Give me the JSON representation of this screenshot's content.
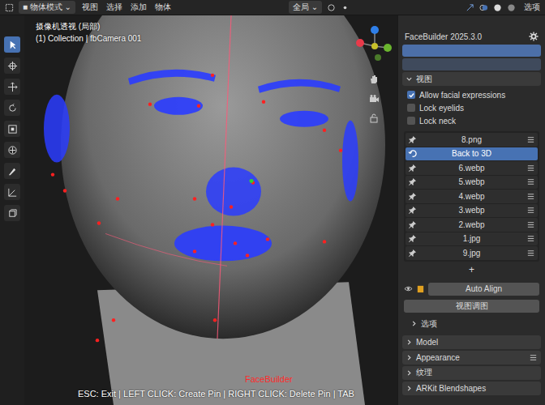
{
  "header": {
    "mode": "物体模式",
    "menus": [
      "视图",
      "选择",
      "添加",
      "物体"
    ],
    "orientation": "全局",
    "options": "选项"
  },
  "viewport": {
    "camera": "摄像机透视 (局部)",
    "collection": "(1) Collection | fbCamera 001",
    "mode_label": "FaceBuilder",
    "hint": "ESC: Exit | LEFT CLICK: Create Pin | RIGHT CLICK: Delete Pin | TAB"
  },
  "tools": [
    {
      "selected": true
    },
    {
      "selected": false
    },
    {
      "selected": false
    },
    {
      "selected": false
    },
    {
      "selected": false
    },
    {
      "selected": false
    },
    {
      "selected": false
    },
    {
      "selected": false
    },
    {
      "selected": false
    }
  ],
  "panel": {
    "title": "FaceBuilder 2025.3.0",
    "section": {
      "label": "视图",
      "expanded": true
    },
    "checkboxes": [
      {
        "label": "Allow facial expressions",
        "checked": true
      },
      {
        "label": "Lock eyelids",
        "checked": false
      },
      {
        "label": "Lock neck",
        "checked": false
      }
    ],
    "views": [
      {
        "label": "8.png",
        "kind": "pin",
        "selected": false
      },
      {
        "label": "Back to 3D",
        "kind": "back",
        "selected": true
      },
      {
        "label": "6.webp",
        "kind": "pin",
        "selected": false
      },
      {
        "label": "5.webp",
        "kind": "pin",
        "selected": false
      },
      {
        "label": "4.webp",
        "kind": "pin",
        "selected": false
      },
      {
        "label": "3.webp",
        "kind": "pin",
        "selected": false
      },
      {
        "label": "2.webp",
        "kind": "pin",
        "selected": false
      },
      {
        "label": "1.jpg",
        "kind": "pin",
        "selected": false
      },
      {
        "label": "9.jpg",
        "kind": "pin",
        "selected": false
      }
    ],
    "add": "+",
    "auto_align": "Auto Align",
    "align_button": "视图调图",
    "subsection": {
      "label": "选项",
      "expanded": false
    },
    "sections": [
      {
        "label": "Model",
        "expanded": false,
        "menu": false
      },
      {
        "label": "Appearance",
        "expanded": false,
        "menu": true
      },
      {
        "label": "纹理",
        "expanded": false,
        "menu": false
      },
      {
        "label": "ARKit Blendshapes",
        "expanded": false,
        "menu": false
      }
    ]
  }
}
